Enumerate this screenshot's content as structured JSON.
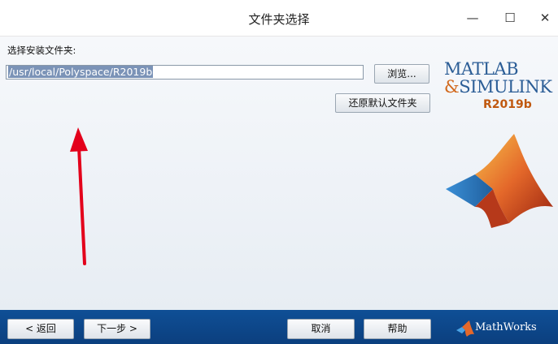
{
  "window": {
    "title": "文件夹选择",
    "minimize_glyph": "—",
    "maximize_glyph": "☐",
    "close_glyph": "✕"
  },
  "form": {
    "label": "选择安装文件夹:",
    "folder_value": "/usr/local/Polyspace/R2019b",
    "browse_label": "浏览...",
    "restore_label": "还原默认文件夹"
  },
  "branding": {
    "line1": "MATLAB",
    "line2_prefix": "&",
    "line2": "SIMULINK",
    "release": "R2019b",
    "company": "MathWorks"
  },
  "footer": {
    "back_label": "< 返回",
    "next_label": "下一步 >",
    "cancel_label": "取消",
    "help_label": "帮助"
  },
  "colors": {
    "footer_bg": "#0f4f96",
    "brand_blue": "#2b5d96",
    "brand_orange": "#c0580f",
    "annotation_red": "#e3001b"
  },
  "icons": [
    "minimize-icon",
    "maximize-icon",
    "close-icon",
    "matlab-membrane-logo",
    "mathworks-logo-icon",
    "red-annotation-arrow"
  ]
}
